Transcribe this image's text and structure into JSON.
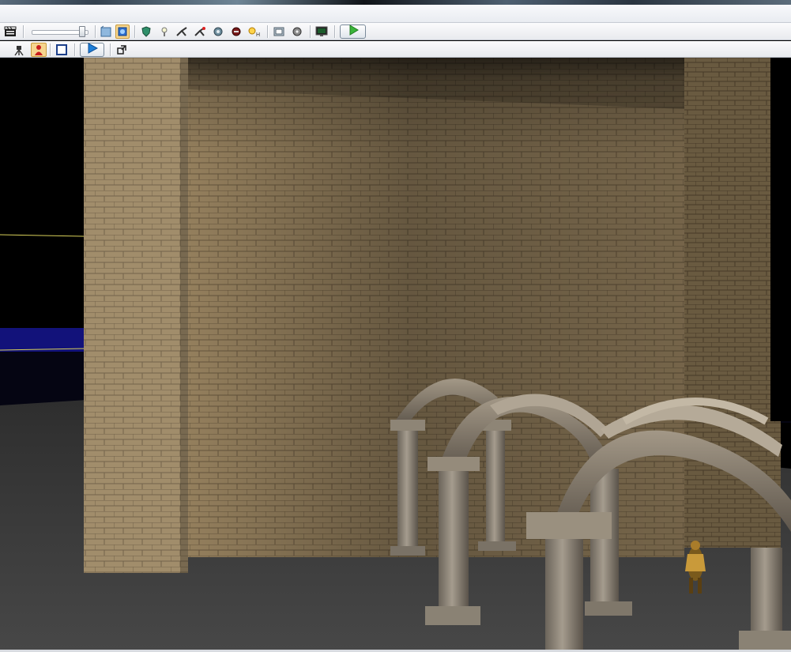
{
  "window": {
    "menubar_items": []
  },
  "toolbar_top": {
    "icons": [
      "clapperboard-icon",
      "camera-speed-slider",
      "cube-wireframe-icon",
      "cube-selected-icon",
      "shield-icon",
      "light-bulb-icon",
      "bone-x-icon",
      "bone-red-icon",
      "camera-rotate-icon",
      "actor-helmet-icon",
      "light-h-icon",
      "panel-icon",
      "reel-icon",
      "monitor-icon",
      "play-in-editor-icon"
    ],
    "accent_color": "#3ab53a"
  },
  "toolbar_bottom": {
    "icons": [
      "tripod-icon",
      "actor-red-icon",
      "square-view-icon",
      "play-blue-icon",
      "maximize-viewport-icon"
    ],
    "accent_color": "#1e7fd8"
  },
  "viewport": {
    "scene": "3d-editor-perspective-view",
    "colors": {
      "sky": "#000000",
      "horizon_band": "#12127a",
      "floor": "#3a3a3a",
      "brick": "#a08a66",
      "brick_shadow": "#5c4c35",
      "column_stone": "#8c8376",
      "guide_line": "#d8d05a"
    }
  }
}
